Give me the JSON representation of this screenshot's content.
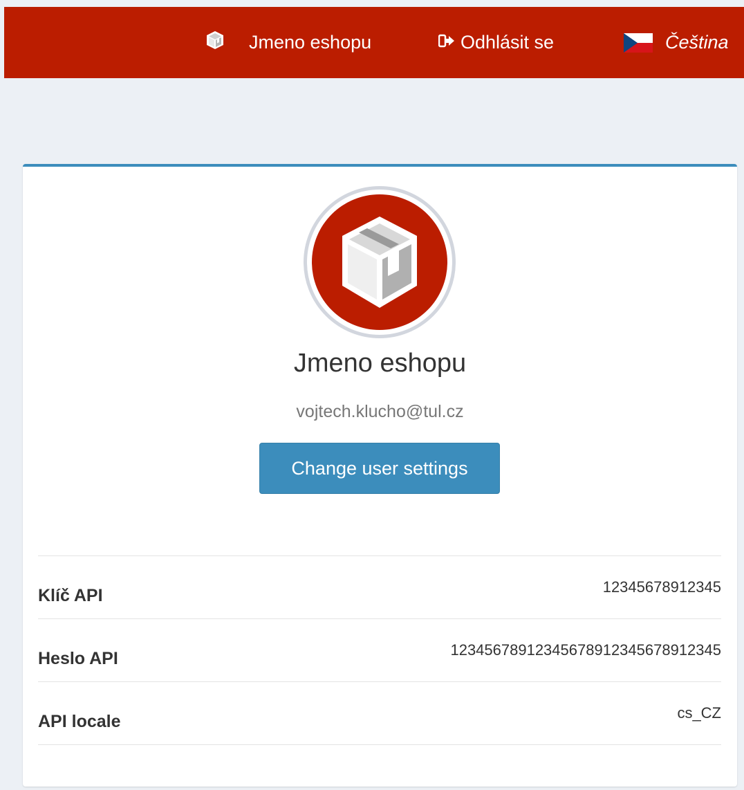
{
  "navbar": {
    "background": "#bb1d00",
    "shop": {
      "icon": "package-icon",
      "label": "Jmeno eshopu"
    },
    "logout": {
      "icon": "sign-out-icon",
      "label": "Odhlásit se"
    },
    "language": {
      "icon": "czech-flag-icon",
      "label": "Čeština"
    }
  },
  "profile": {
    "avatar_icon": "package-icon",
    "name": "Jmeno eshopu",
    "email": "vojtech.klucho@tul.cz",
    "settings_button": "Change user settings"
  },
  "api_info": [
    {
      "label": "Klíč API",
      "value": "12345678912345"
    },
    {
      "label": "Heslo API",
      "value": "1234567891234567891234567891234​5"
    },
    {
      "label": "API locale",
      "value": "cs_CZ"
    }
  ],
  "colors": {
    "header": "#bb1d00",
    "accent": "#3c8dbc",
    "page_background": "#ecf0f5"
  }
}
